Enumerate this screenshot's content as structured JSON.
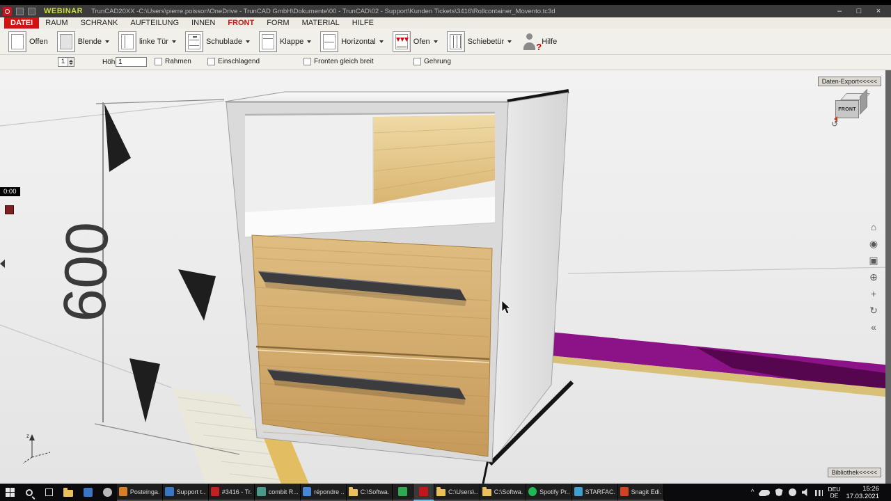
{
  "titlebar": {
    "webinar": "WEBINAR",
    "title": "TrunCAD20XX -C:\\Users\\pierre.poisson\\OneDrive - TrunCAD GmbH\\Dokumente\\00 - TrunCAD\\02 - Support\\Kunden Tickets\\3416\\Rollcontainer_Movento.tc3d",
    "controls": {
      "minimize": "–",
      "maximize": "□",
      "close": "×"
    }
  },
  "menubar": {
    "items": [
      "DATEI",
      "RAUM",
      "SCHRANK",
      "AUFTEILUNG",
      "INNEN",
      "FRONT",
      "FORM",
      "MATERIAL",
      "HILFE"
    ]
  },
  "toolbar": {
    "buttons": [
      {
        "label": "Offen"
      },
      {
        "label": "Blende"
      },
      {
        "label": "linke Tür"
      },
      {
        "label": "Schublade"
      },
      {
        "label": "Klappe"
      },
      {
        "label": "Horizontal"
      },
      {
        "label": "Ofen"
      },
      {
        "label": "Schiebetür"
      },
      {
        "label": "Hilfe"
      }
    ],
    "hilfe_q": "?"
  },
  "optionsbar": {
    "spinner_value": "1",
    "hoehe_label": "Höhe",
    "hoehe_value": "1",
    "checkboxes": [
      "Rahmen",
      "Einschlagend",
      "Fronten gleich breit",
      "Gehrung"
    ]
  },
  "viewport": {
    "dimension_label": "600",
    "rec_time": "0:00",
    "daten_export_label": "Daten-Export<<<<<",
    "bibliothek_label": "Bibliothek<<<<<",
    "cube_label": "FRONT",
    "cube_rotate_glyph": "↺",
    "axis_label": "z",
    "side_tools": [
      {
        "name": "home",
        "glyph": "⌂"
      },
      {
        "name": "orbit",
        "glyph": "◉"
      },
      {
        "name": "zoom-window",
        "glyph": "▣"
      },
      {
        "name": "zoom",
        "glyph": "⊕"
      },
      {
        "name": "pan",
        "glyph": "+"
      },
      {
        "name": "rotate",
        "glyph": "↻"
      },
      {
        "name": "collapse",
        "glyph": "«"
      }
    ]
  },
  "taskbar": {
    "apps": [
      {
        "label": "Posteinga..."
      },
      {
        "label": "Support t..."
      },
      {
        "label": "#3416 - Tr..."
      },
      {
        "label": "combit R..."
      },
      {
        "label": "répondre ..."
      },
      {
        "label": "C:\\Softwa..."
      },
      {
        "label": "C:\\Users\\..."
      },
      {
        "label": "C:\\Softwa..."
      },
      {
        "label": "Spotify Pr..."
      },
      {
        "label": "STARFAC..."
      },
      {
        "label": "Snagit Edi..."
      }
    ],
    "tray": {
      "caret": "^",
      "lang_top": "DEU",
      "lang_bottom": "DE",
      "time": "15:26",
      "date": "17.03.2021"
    }
  },
  "colors": {
    "accent_red": "#cf1212",
    "purple_floor": "#8c1288",
    "wood": "#d3a964",
    "taskbar_bg": "#0b0b0d"
  }
}
